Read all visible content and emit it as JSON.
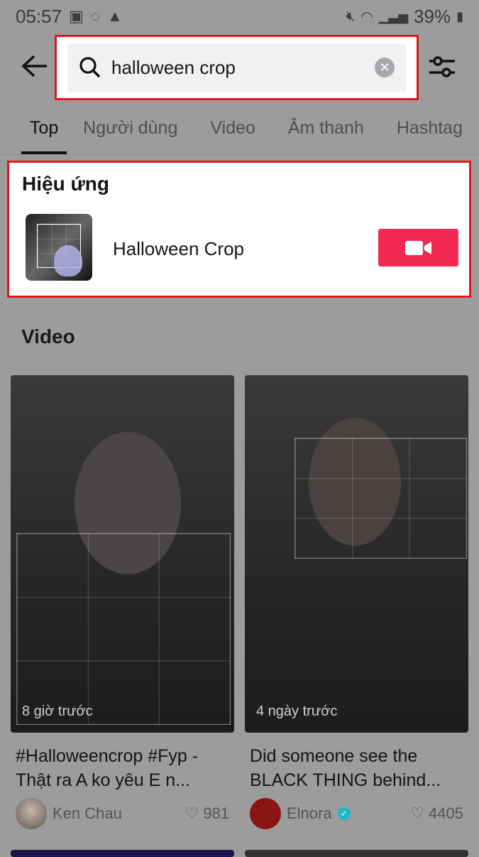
{
  "status": {
    "time": "05:57",
    "battery": "39%"
  },
  "search": {
    "query": "halloween crop"
  },
  "tabs": [
    "Top",
    "Người dùng",
    "Video",
    "Âm thanh",
    "Hashtag"
  ],
  "effects": {
    "heading": "Hiệu ứng",
    "name": "Halloween Crop"
  },
  "videos": {
    "heading": "Video",
    "items": [
      {
        "time": "8 giờ trước",
        "title": "#Halloweencrop #Fyp - Thật ra A ko yêu E n...",
        "author": "Ken Chau",
        "likes": "981",
        "verified": false
      },
      {
        "time": "4 ngày trước",
        "title": "Did someone see the BLACK THING behind...",
        "author": "Elnora",
        "likes": "4405",
        "verified": true
      }
    ]
  },
  "colors": {
    "accent": "#f02a55",
    "highlight": "#e0161c"
  }
}
